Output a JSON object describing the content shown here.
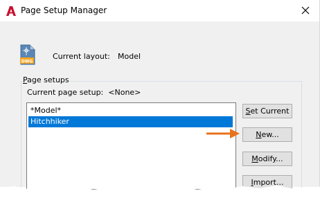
{
  "window": {
    "title": "Page Setup Manager"
  },
  "layout": {
    "label": "Current layout:",
    "value": "Model",
    "icon_text": "DWG"
  },
  "page_setups": {
    "group_title_mnemonic": "P",
    "group_title_rest": "age setups",
    "current_label": "Current page setup:",
    "current_value": "<None>",
    "items": [
      {
        "label": "*Model*",
        "selected": false
      },
      {
        "label": "Hitchhiker",
        "selected": true
      }
    ]
  },
  "buttons": {
    "set_current": {
      "mnemonic": "S",
      "rest": "et Current"
    },
    "new": {
      "mnemonic": "N",
      "rest": "ew..."
    },
    "modify": {
      "mnemonic": "M",
      "rest": "odify..."
    },
    "import": {
      "mnemonic": "I",
      "rest": "mport..."
    }
  },
  "colors": {
    "accent": "#0078d7",
    "arrow": "#e8731c",
    "autocad_red": "#c8102e"
  }
}
